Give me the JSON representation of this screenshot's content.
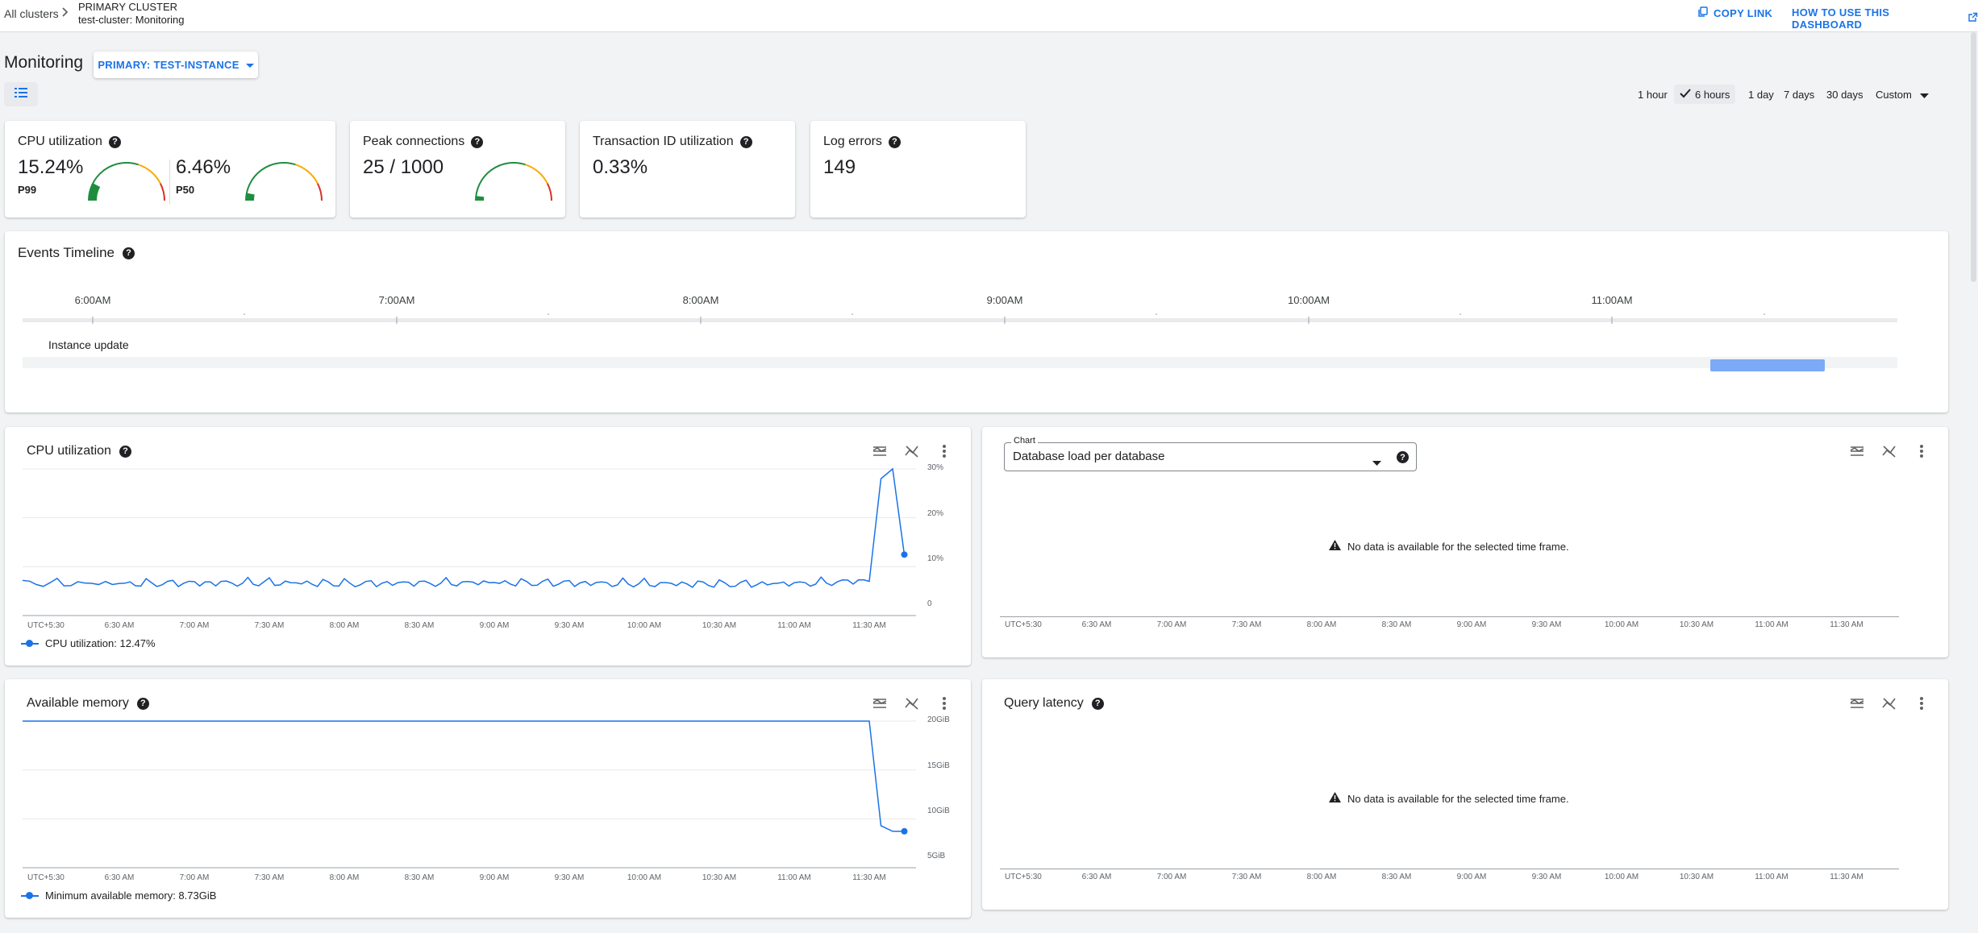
{
  "breadcrumb": {
    "all_clusters": "All clusters",
    "cluster_type": "PRIMARY CLUSTER",
    "current": "test-cluster: Monitoring"
  },
  "header_links": {
    "copy_link": "COPY LINK",
    "how_to": "HOW TO USE THIS DASHBOARD"
  },
  "page": {
    "title": "Monitoring",
    "instance_selector": "PRIMARY: TEST-INSTANCE"
  },
  "time_ranges": {
    "options": [
      "1 hour",
      "6 hours",
      "1 day",
      "7 days",
      "30 days",
      "Custom"
    ],
    "selected": "6 hours"
  },
  "metrics": {
    "cpu": {
      "title": "CPU utilization",
      "p99_value": "15.24%",
      "p99_label": "P99",
      "p50_value": "6.46%",
      "p50_label": "P50",
      "p99_fraction": 0.1524,
      "p50_fraction": 0.0646
    },
    "connections": {
      "title": "Peak connections",
      "value": "25 / 1000",
      "fraction": 0.025
    },
    "txid": {
      "title": "Transaction ID utilization",
      "value": "0.33%"
    },
    "log_errors": {
      "title": "Log errors",
      "value": "149"
    }
  },
  "events": {
    "title": "Events Timeline",
    "ticks": [
      "6:00AM",
      "7:00AM",
      "8:00AM",
      "9:00AM",
      "10:00AM",
      "11:00AM"
    ],
    "row_label": "Instance update",
    "event_start": "11:13AM",
    "event_end": "11:36AM"
  },
  "x_axis_labels": [
    "UTC+5:30",
    "6:30 AM",
    "7:00 AM",
    "7:30 AM",
    "8:00 AM",
    "8:30 AM",
    "9:00 AM",
    "9:30 AM",
    "10:00 AM",
    "10:30 AM",
    "11:00 AM",
    "11:30 AM"
  ],
  "panels": {
    "cpu": {
      "title": "CPU utilization",
      "y_ticks": [
        "30%",
        "20%",
        "10%",
        "0"
      ],
      "legend": "CPU utilization:  12.47%"
    },
    "db_load": {
      "chart_label": "Chart",
      "chart_value": "Database load per database",
      "no_data": "No data is available for the selected time frame."
    },
    "memory": {
      "title": "Available memory",
      "y_ticks": [
        "20GiB",
        "15GiB",
        "10GiB",
        "5GiB"
      ],
      "legend": "Minimum available memory:  8.73GiB"
    },
    "latency": {
      "title": "Query latency",
      "no_data": "No data is available for the selected time frame."
    }
  },
  "colors": {
    "accent": "#1a73e8",
    "gauge_low": "#1e8e3e",
    "gauge_mid": "#f9ab00",
    "gauge_high": "#d93025"
  },
  "chart_data": [
    {
      "type": "line",
      "title": "CPU utilization",
      "x": [
        "5:30",
        "6:30",
        "7:00",
        "7:30",
        "8:00",
        "8:30",
        "9:00",
        "9:30",
        "10:00",
        "10:30",
        "11:00",
        "11:30",
        "11:40",
        "11:45",
        "11:50"
      ],
      "ylim": [
        0,
        30
      ],
      "series": [
        {
          "name": "CPU utilization",
          "values": [
            6.5,
            6.4,
            6.5,
            6.6,
            6.4,
            6.5,
            6.6,
            6.5,
            6.4,
            6.3,
            6.4,
            7,
            28,
            30,
            12.47
          ]
        }
      ]
    },
    {
      "type": "line",
      "title": "Available memory",
      "x": [
        "5:30",
        "6:30",
        "7:00",
        "7:30",
        "8:00",
        "8:30",
        "9:00",
        "9:30",
        "10:00",
        "10:30",
        "11:00",
        "11:30",
        "11:31",
        "11:40",
        "11:50"
      ],
      "ylim": [
        5,
        20
      ],
      "series": [
        {
          "name": "Minimum available memory",
          "values": [
            20,
            20,
            20,
            20,
            20,
            20,
            20,
            20,
            20,
            20,
            20,
            20,
            9.3,
            8.73,
            8.73
          ]
        }
      ]
    }
  ]
}
